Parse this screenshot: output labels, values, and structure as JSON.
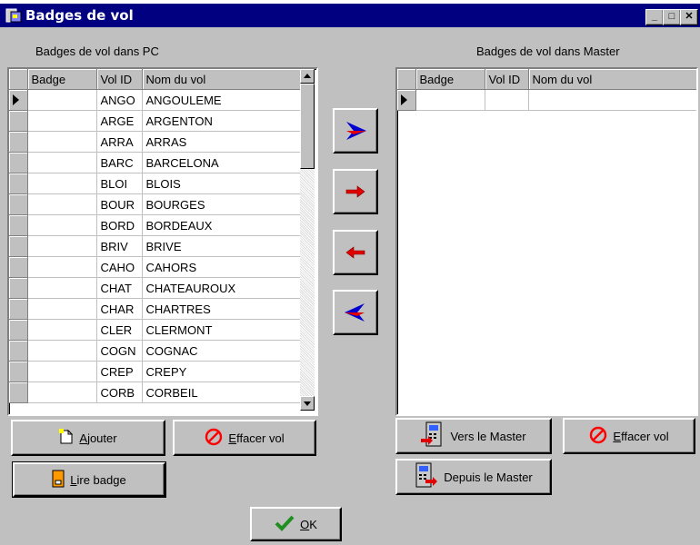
{
  "window": {
    "title": "Badges de vol"
  },
  "left_panel": {
    "heading": "Badges de vol dans PC",
    "columns": [
      "Badge",
      "Vol ID",
      "Nom du vol"
    ],
    "rows": [
      {
        "badge": "",
        "id": "ANGO",
        "name": "ANGOULEME"
      },
      {
        "badge": "",
        "id": "ARGE",
        "name": "ARGENTON"
      },
      {
        "badge": "",
        "id": "ARRA",
        "name": "ARRAS"
      },
      {
        "badge": "",
        "id": "BARC",
        "name": "BARCELONA"
      },
      {
        "badge": "",
        "id": "BLOI",
        "name": "BLOIS"
      },
      {
        "badge": "",
        "id": "BOUR",
        "name": "BOURGES"
      },
      {
        "badge": "",
        "id": "BORD",
        "name": "BORDEAUX"
      },
      {
        "badge": "",
        "id": "BRIV",
        "name": "BRIVE"
      },
      {
        "badge": "",
        "id": "CAHO",
        "name": "CAHORS"
      },
      {
        "badge": "",
        "id": "CHAT",
        "name": "CHATEAUROUX"
      },
      {
        "badge": "",
        "id": "CHAR",
        "name": "CHARTRES"
      },
      {
        "badge": "",
        "id": "CLER",
        "name": "CLERMONT"
      },
      {
        "badge": "",
        "id": "COGN",
        "name": "COGNAC"
      },
      {
        "badge": "",
        "id": "CREP",
        "name": "CREPY"
      },
      {
        "badge": "",
        "id": "CORB",
        "name": "CORBEIL"
      }
    ],
    "buttons": {
      "add": {
        "pre": "",
        "u": "A",
        "post": "jouter"
      },
      "delete": {
        "pre": "",
        "u": "E",
        "post": "ffacer vol"
      },
      "read": {
        "pre": "",
        "u": "L",
        "post": "ire badge"
      }
    }
  },
  "right_panel": {
    "heading": "Badges de vol dans Master",
    "columns": [
      "Badge",
      "Vol ID",
      "Nom du vol"
    ],
    "buttons": {
      "to_master": "Vers le Master",
      "delete": {
        "pre": "",
        "u": "E",
        "post": "ffacer vol"
      },
      "from_master": "Depuis le Master"
    }
  },
  "ok_button": {
    "pre": "",
    "u": "O",
    "post": "K"
  },
  "colors": {
    "arrow_blue": "#0000d0",
    "arrow_red": "#e00000",
    "title_bar": "#000080",
    "ok_check": "#1f8f1f"
  },
  "icons": {
    "title": "badge-app-icon",
    "move_all_right": "double-arrow-right-icon",
    "move_one_right": "arrow-right-icon",
    "move_one_left": "arrow-left-icon",
    "move_all_left": "double-arrow-left-icon"
  }
}
